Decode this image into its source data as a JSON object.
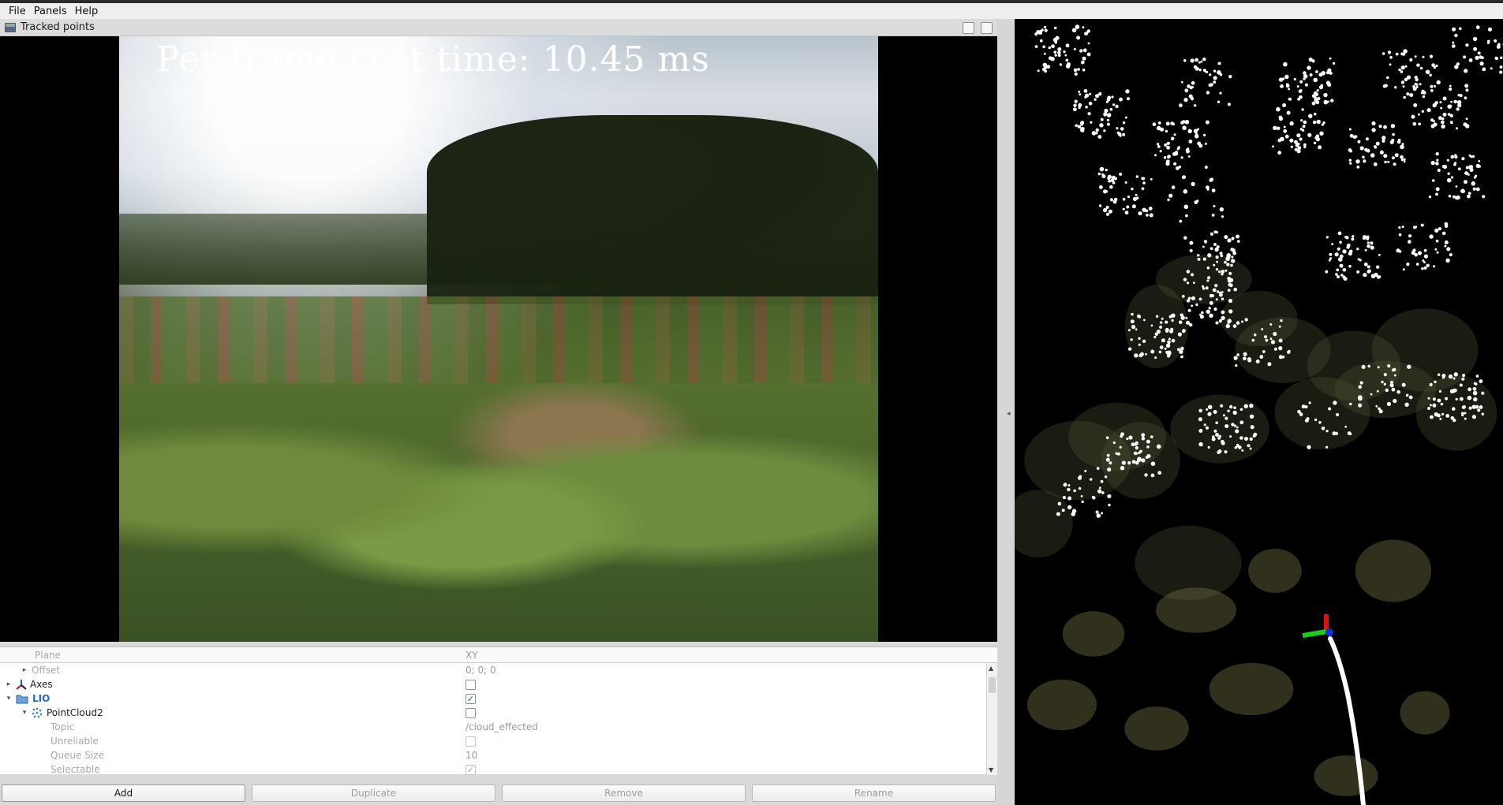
{
  "menubar": {
    "items": [
      "File",
      "Panels",
      "Help"
    ]
  },
  "image_panel": {
    "title": "Tracked points",
    "overlay_text": "Per-frame cost time: 10.45 ms"
  },
  "properties": {
    "rows": [
      {
        "name": "Plane",
        "value": "XY"
      },
      {
        "name": "Offset",
        "value": "0; 0; 0"
      },
      {
        "name": "Axes",
        "checked": false
      },
      {
        "name": "LIO",
        "checked": true
      },
      {
        "name": "PointCloud2",
        "checked": false
      },
      {
        "name": "Topic",
        "value": "/cloud_effected"
      },
      {
        "name": "Unreliable",
        "checked": false
      },
      {
        "name": "Queue Size",
        "value": "10"
      },
      {
        "name": "Selectable",
        "checked": true
      }
    ]
  },
  "buttons": {
    "add": "Add",
    "duplicate": "Duplicate",
    "remove": "Remove",
    "rename": "Rename"
  },
  "colors": {
    "lio_label": "#1d6fc4",
    "axis_x": "#e01010",
    "axis_y": "#10d010",
    "axis_z": "#1030e0",
    "trajectory": "#ffffff"
  }
}
